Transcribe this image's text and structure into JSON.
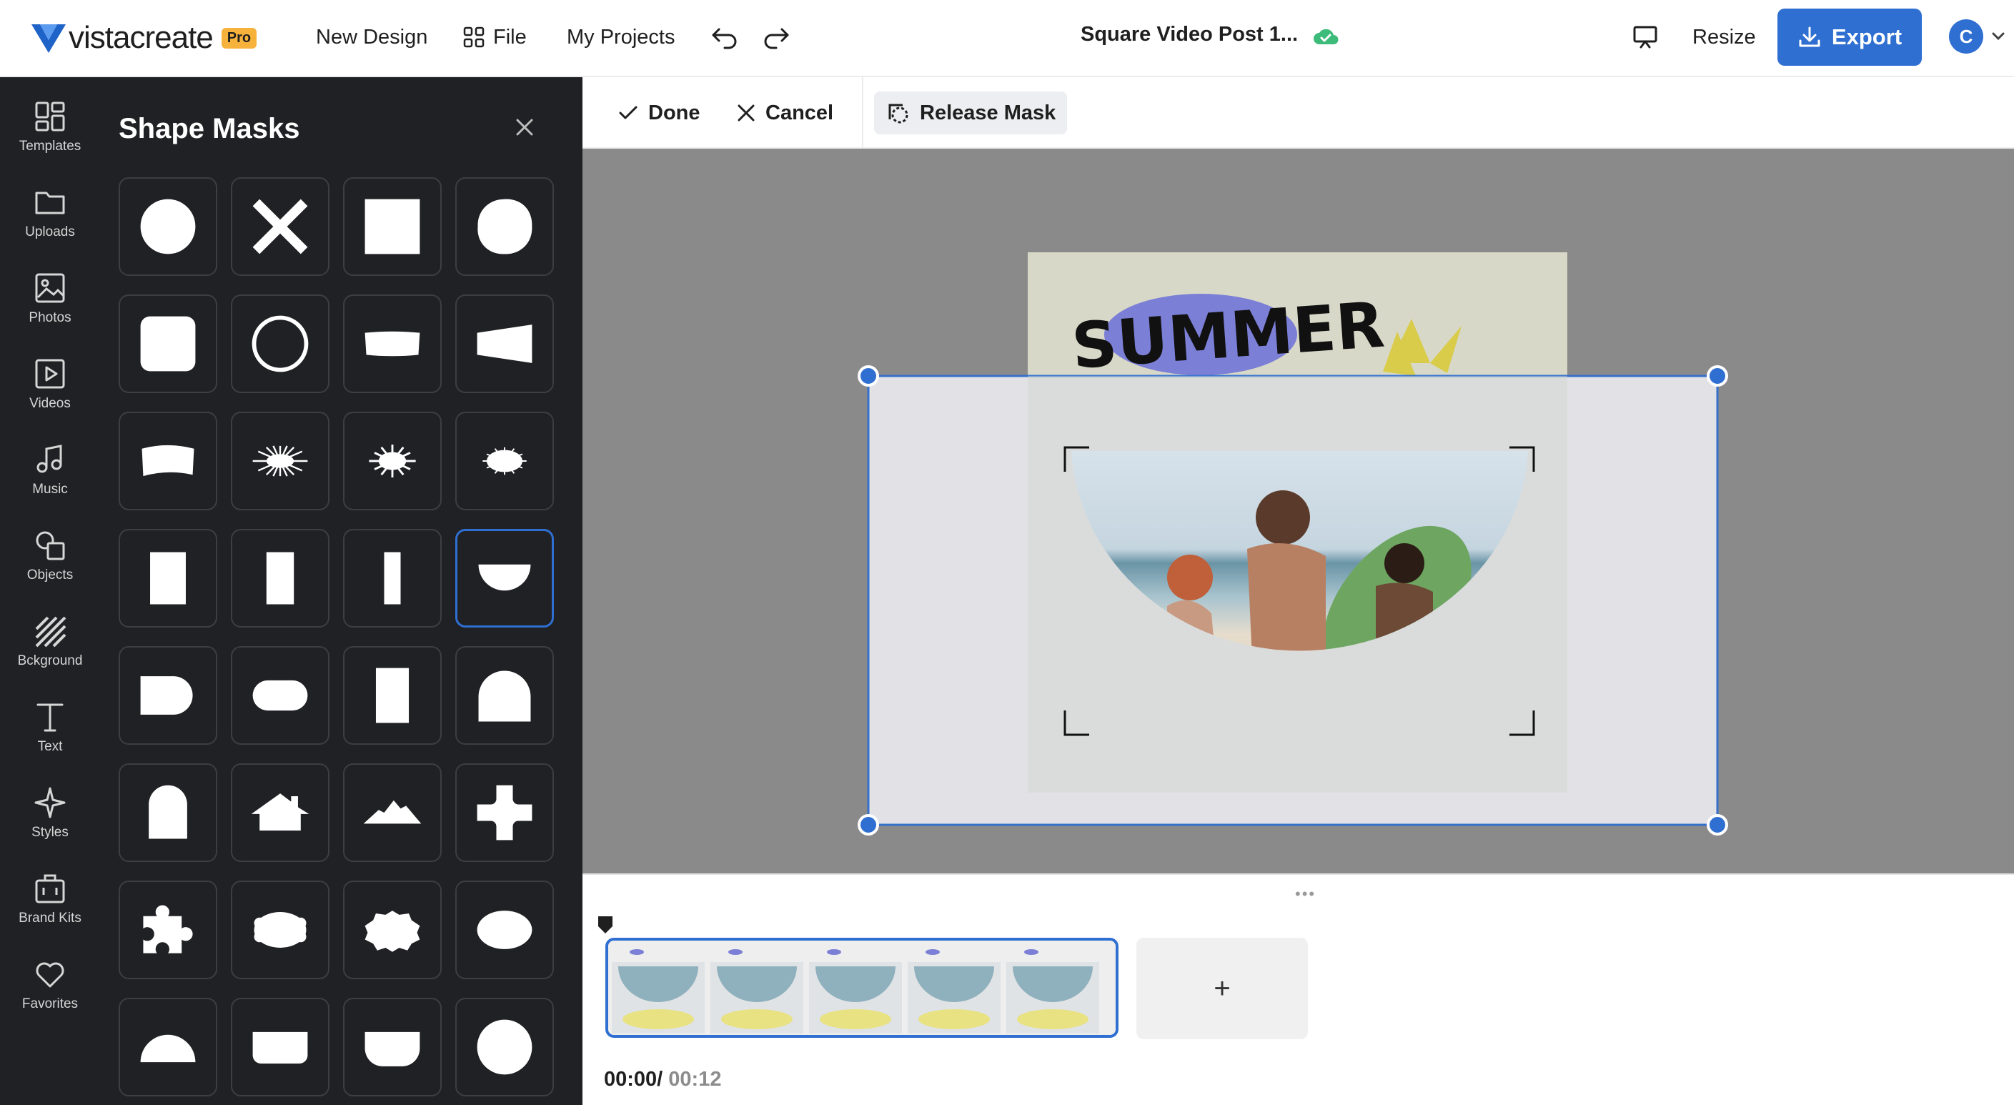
{
  "topbar": {
    "logo_text": "vistacreate",
    "pro_badge": "Pro",
    "new_design": "New Design",
    "file": "File",
    "my_projects": "My Projects",
    "doc_title": "Square Video Post 1...",
    "resize": "Resize",
    "export": "Export",
    "avatar_initial": "C"
  },
  "rail": {
    "items": [
      {
        "label": "Templates",
        "icon": "templates-icon"
      },
      {
        "label": "Uploads",
        "icon": "folder-icon"
      },
      {
        "label": "Photos",
        "icon": "image-icon"
      },
      {
        "label": "Videos",
        "icon": "play-icon"
      },
      {
        "label": "Music",
        "icon": "music-icon"
      },
      {
        "label": "Objects",
        "icon": "shapes-icon"
      },
      {
        "label": "Bckground",
        "icon": "stripes-icon"
      },
      {
        "label": "Text",
        "icon": "text-icon"
      },
      {
        "label": "Styles",
        "icon": "sparkle-icon"
      },
      {
        "label": "Brand Kits",
        "icon": "briefcase-icon"
      },
      {
        "label": "Favorites",
        "icon": "heart-icon"
      }
    ]
  },
  "panel": {
    "title": "Shape Masks",
    "shapes": [
      "circle",
      "cross",
      "square",
      "rough-circle",
      "rounded-square",
      "ring",
      "wave-rect",
      "trapezoid",
      "curved-banner",
      "starburst-thin",
      "starburst",
      "starburst-oval",
      "portrait-rect",
      "tall-rect",
      "thin-rect",
      "half-circle-bottom",
      "d-shape",
      "pill",
      "tall-rect-2",
      "arch",
      "arch-tall",
      "house",
      "mountain",
      "puzzle-cross",
      "puzzle-piece",
      "scalloped-oval",
      "badge",
      "oval",
      "half-circle-top",
      "rounded-bottom",
      "cup",
      "circle-2"
    ],
    "selected_index": 15
  },
  "edit_bar": {
    "done": "Done",
    "cancel": "Cancel",
    "release_mask": "Release Mask"
  },
  "canvas": {
    "headline": "SUMMER",
    "colors": {
      "selection": "#2f6fd1",
      "headline_blob": "#7b7fd6"
    }
  },
  "timeline": {
    "current_time": "00:00/",
    "total_time": "00:12",
    "add_scene": "+"
  },
  "colors": {
    "accent": "#2f6fd1",
    "sidebar_bg": "#202124",
    "canvas_bg": "#8a8a8a",
    "cloud_saved": "#3dbb7a"
  }
}
